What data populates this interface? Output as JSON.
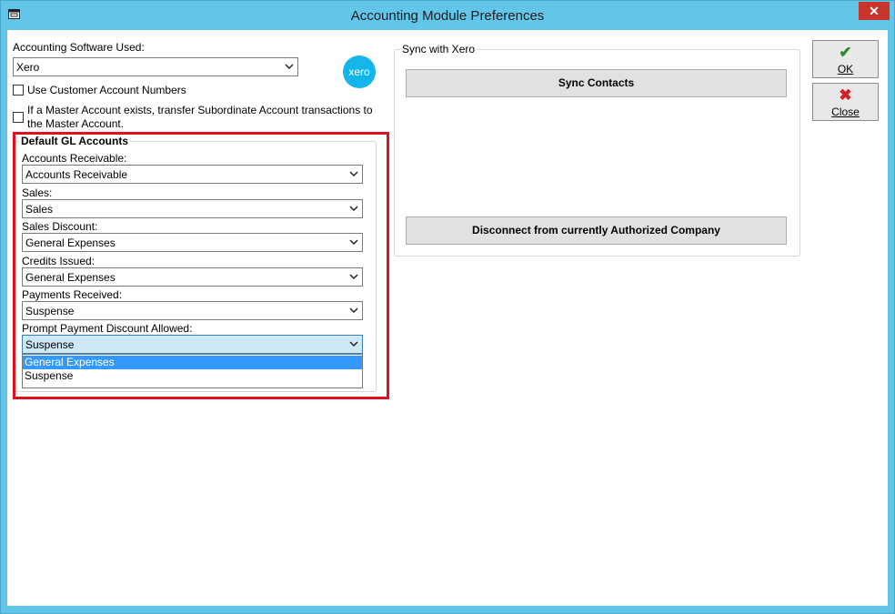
{
  "window": {
    "title": "Accounting Module Preferences",
    "close_glyph": "✕"
  },
  "software": {
    "label": "Accounting Software Used:",
    "value": "Xero",
    "logo_text": "xero",
    "use_customer_numbers": "Use Customer Account Numbers",
    "transfer_text_line1": "If a Master Account exists, transfer Subordinate Account transactions to",
    "transfer_text_line2": "the Master Account."
  },
  "gl": {
    "title": "Default GL Accounts",
    "fields": [
      {
        "label": "Accounts Receivable:",
        "value": "Accounts Receivable"
      },
      {
        "label": "Sales:",
        "value": "Sales"
      },
      {
        "label": "Sales Discount:",
        "value": "General Expenses"
      },
      {
        "label": "Credits Issued:",
        "value": "General Expenses"
      },
      {
        "label": "Payments Received:",
        "value": "Suspense"
      },
      {
        "label": "Prompt Payment Discount Allowed:",
        "value": "Suspense"
      }
    ],
    "dropdown_options": [
      "General Expenses",
      "Suspense"
    ]
  },
  "sync": {
    "title": "Sync with Xero",
    "sync_contacts": "Sync Contacts",
    "disconnect": "Disconnect from currently Authorized Company"
  },
  "buttons": {
    "ok_label": "OK",
    "close_label": "Close",
    "ok_icon": "✔",
    "close_icon": "✖"
  },
  "colors": {
    "titlebar": "#62c6ea",
    "close_button": "#c7352b",
    "highlight_box": "#e0101c",
    "selected_item": "#3399ff",
    "xero_brand": "#13b5ea"
  }
}
